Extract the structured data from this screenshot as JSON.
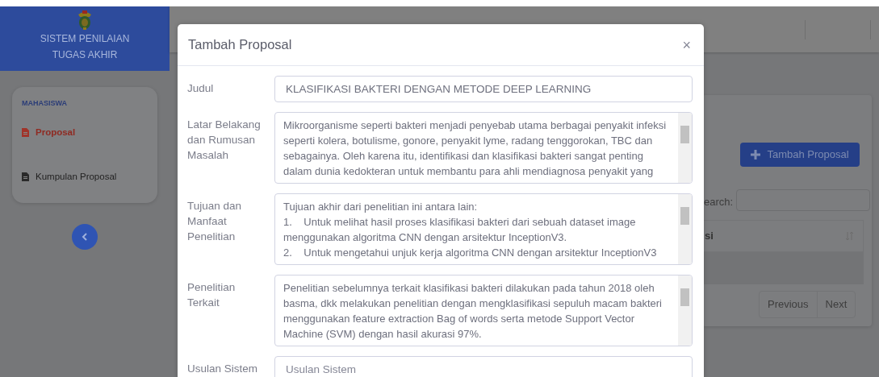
{
  "sidebar": {
    "brand": "SISTEM PENILAIAN TUGAS AKHIR",
    "section": "MAHASISWA",
    "items": [
      {
        "label": "Proposal",
        "selected": true
      },
      {
        "label": "Kumpulan Proposal",
        "selected": false
      }
    ]
  },
  "page": {
    "add_button": "Tambah Proposal",
    "search_label": "earch:",
    "table_header": "si",
    "pagination": [
      "Previous",
      "Next"
    ]
  },
  "modal": {
    "title": "Tambah Proposal",
    "close": "×",
    "fields": [
      {
        "label": "Judul",
        "kind": "input",
        "value": "KLASIFIKASI BAKTERI DENGAN METODE DEEP LEARNING"
      },
      {
        "label": "Latar Belakang dan Rumusan Masalah",
        "kind": "textarea",
        "lines": [
          "Mikroorganisme seperti bakteri menjadi penyebab utama berbagai penyakit infeksi",
          "seperti kolera, botulisme, gonore, penyakit lyme, radang tenggorokan, TBC dan",
          "sebagainya. Oleh karena itu, identifikasi dan klasifikasi bakteri sangat penting",
          "dalam dunia kedokteran untuk membantu para ahli mendiagnosa penyakit yang"
        ]
      },
      {
        "label": "Tujuan dan Manfaat Penelitian",
        "kind": "textarea",
        "lines": [
          "Tujuan akhir dari penelitian ini antara lain:",
          "1.    Untuk melihat hasil proses klasifikasi bakteri dari sebuah dataset image",
          "menggunakan algoritma CNN dengan arsitektur InceptionV3.",
          "2.    Untuk mengetahui unjuk kerja algoritma CNN dengan arsitektur InceptionV3"
        ]
      },
      {
        "label": "Penelitian Terkait",
        "kind": "textarea",
        "lines": [
          "Penelitian sebelumnya terkait klasifikasi bakteri dilakukan pada tahun 2018 oleh",
          "basma, dkk melakukan penelitian dengan mengklasifikasi sepuluh macam bakteri",
          "menggunakan feature extraction Bag of words serta metode Support Vector",
          "Machine (SVM) dengan hasil akurasi 97%."
        ]
      },
      {
        "label": "Usulan Sistem",
        "kind": "input",
        "placeholder": "Usulan Sistem"
      }
    ]
  }
}
